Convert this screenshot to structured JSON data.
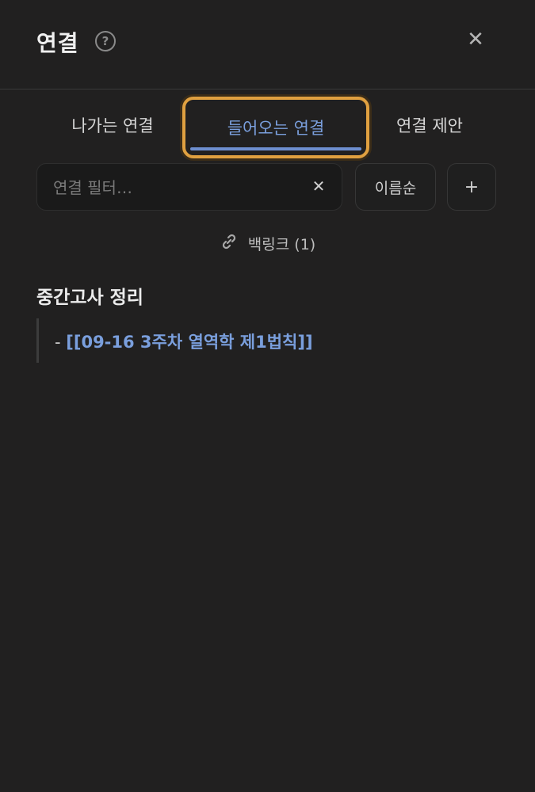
{
  "header": {
    "title": "연결",
    "help_glyph": "?",
    "close_glyph": "✕"
  },
  "tabs": [
    {
      "label": "나가는 연결",
      "active": false
    },
    {
      "label": "들어오는 연결",
      "active": true
    },
    {
      "label": "연결 제안",
      "active": false
    }
  ],
  "filter": {
    "placeholder": "연결 필터…",
    "value": "",
    "clear_glyph": "✕"
  },
  "sort_label": "이름순",
  "add_label": "+",
  "backlinks": {
    "label": "백링크 (1)",
    "groups": [
      {
        "title": "중간고사 정리",
        "items": [
          {
            "prefix": "- ",
            "link_text": "[[09-16 3주차 열역학 제1법칙]]"
          }
        ]
      }
    ]
  },
  "colors": {
    "background": "#212020",
    "accent_link": "#7a9fdd",
    "highlight": "#e0a040"
  }
}
